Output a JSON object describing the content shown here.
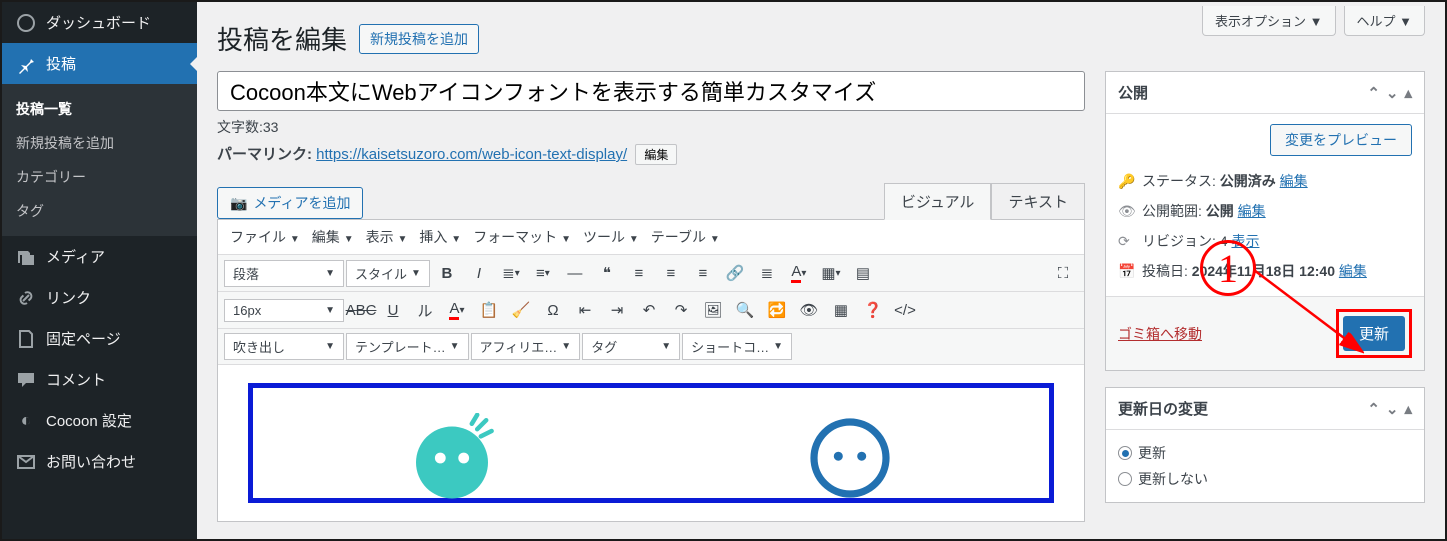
{
  "sidebar": {
    "items": [
      {
        "label": "ダッシュボード",
        "icon": "dashboard"
      },
      {
        "label": "投稿",
        "icon": "pin"
      },
      {
        "label": "メディア",
        "icon": "media"
      },
      {
        "label": "リンク",
        "icon": "link"
      },
      {
        "label": "固定ページ",
        "icon": "page"
      },
      {
        "label": "コメント",
        "icon": "comment"
      },
      {
        "label": "Cocoon 設定",
        "icon": "cocoon"
      },
      {
        "label": "お問い合わせ",
        "icon": "mail"
      }
    ],
    "submenu": [
      "投稿一覧",
      "新規投稿を追加",
      "カテゴリー",
      "タグ"
    ]
  },
  "top_tabs": {
    "display_options": "表示オプション",
    "help": "ヘルプ"
  },
  "page": {
    "title": "投稿を編集",
    "add_new": "新規投稿を追加",
    "post_title": "Cocoon本文にWebアイコンフォントを表示する簡単カスタマイズ",
    "char_count_label": "文字数:",
    "char_count": "33",
    "permalink_label": "パーマリンク:",
    "permalink_url": "https://kaisetsuzoro.com/web-icon-text-display/",
    "edit_btn": "編集"
  },
  "editor": {
    "add_media": "メディアを追加",
    "tab_visual": "ビジュアル",
    "tab_text": "テキスト",
    "menus": [
      "ファイル",
      "編集",
      "表示",
      "挿入",
      "フォーマット",
      "ツール",
      "テーブル"
    ],
    "row1_sel1": "段落",
    "row1_sel2": "スタイル",
    "row2_sel1": "16px",
    "row3_sel1": "吹き出し",
    "row3_sel2": "テンプレート…",
    "row3_sel3": "アフィリエ…",
    "row3_sel4": "タグ",
    "row3_sel5": "ショートコ…"
  },
  "publish": {
    "heading": "公開",
    "preview": "変更をプレビュー",
    "status_label": "ステータス:",
    "status_value": "公開済み",
    "visibility_label": "公開範囲:",
    "visibility_value": "公開",
    "revision_label": "リビジョン:",
    "revision_value": "4",
    "revision_link": "表示",
    "date_label": "投稿日:",
    "date_value": "2024年11月18日 12:40",
    "edit_link": "編集",
    "trash": "ゴミ箱へ移動",
    "update": "更新"
  },
  "update_date": {
    "heading": "更新日の変更",
    "opt1": "更新",
    "opt2": "更新しない"
  },
  "annotation": {
    "number": "1"
  }
}
